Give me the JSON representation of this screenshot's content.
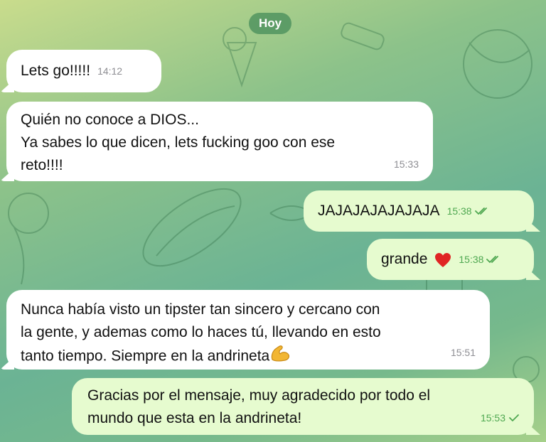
{
  "date_label": "Hoy",
  "messages": [
    {
      "direction": "incoming",
      "lines": [
        "Lets go!!!!!"
      ],
      "time": "14:12"
    },
    {
      "direction": "incoming",
      "lines": [
        "Quién no conoce a DIOS...",
        "Ya sabes lo que dicen, lets fucking goo con ese",
        "reto!!!!"
      ],
      "time": "15:33"
    },
    {
      "direction": "outgoing",
      "lines": [
        "JAJAJAJAJAJAJA"
      ],
      "time": "15:38",
      "status": "read"
    },
    {
      "direction": "outgoing",
      "lines": [
        "grande"
      ],
      "emoji": "red-heart-icon",
      "time": "15:38",
      "status": "read"
    },
    {
      "direction": "incoming",
      "lines": [
        "Nunca había visto un tipster tan sincero y cercano con",
        "la gente, y ademas como lo haces tú, llevando en esto",
        "tanto tiempo. Siempre en la andrineta"
      ],
      "emoji": "flexed-biceps-icon",
      "time": "15:51"
    },
    {
      "direction": "outgoing",
      "lines": [
        "Gracias por el mensaje, muy agradecido por todo el",
        "mundo que esta en la andrineta!"
      ],
      "time": "15:53",
      "status": "delivered"
    }
  ],
  "colors": {
    "incoming_bubble": "#ffffff",
    "outgoing_bubble": "#e6fbcf",
    "outgoing_meta": "#4fa851",
    "incoming_meta": "#8e8e93",
    "heart": "#e02424"
  }
}
